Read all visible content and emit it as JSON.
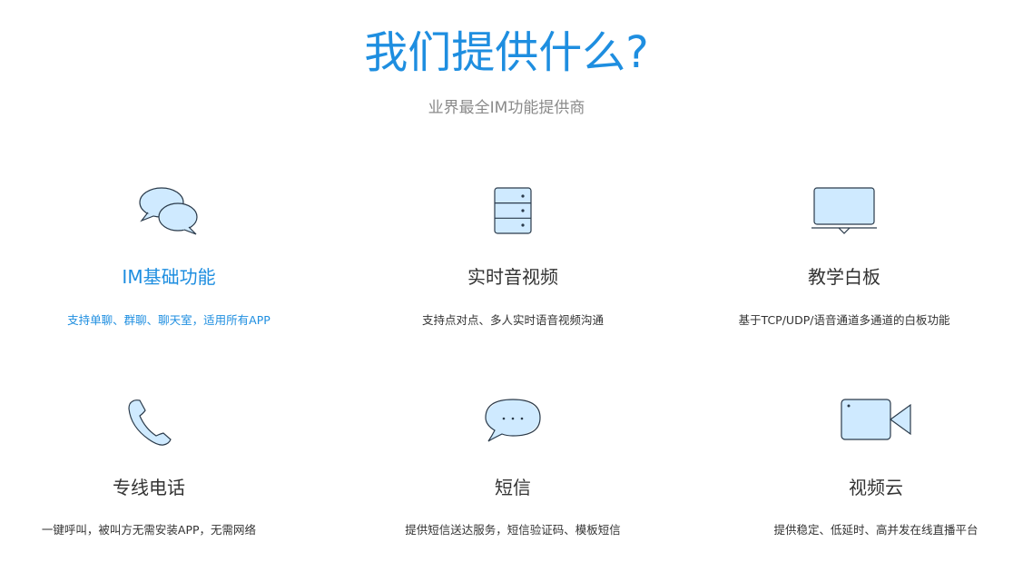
{
  "hero": {
    "title": "我们提供什么?",
    "subtitle": "业界最全IM功能提供商"
  },
  "colors": {
    "accent": "#1e8ee0",
    "text": "#333333",
    "subtle": "#8a8a8a",
    "icon_fill": "#cfeaff"
  },
  "features": [
    {
      "name": "IM基础功能",
      "desc": "支持单聊、群聊、聊天室，适用所有APP",
      "icon": "chat-bubbles-icon",
      "active": true
    },
    {
      "name": "实时音视频",
      "desc": "支持点对点、多人实时语音视频沟通",
      "icon": "server-icon",
      "active": false
    },
    {
      "name": "教学白板",
      "desc": "基于TCP/UDP/语音通道多通道的白板功能",
      "icon": "whiteboard-icon",
      "active": false
    },
    {
      "name": "专线电话",
      "desc": "一键呼叫，被叫方无需安装APP，无需网络",
      "icon": "phone-icon",
      "active": false
    },
    {
      "name": "短信",
      "desc": "提供短信送达服务，短信验证码、模板短信",
      "icon": "message-bubble-icon",
      "active": false
    },
    {
      "name": "视频云",
      "desc": "提供稳定、低延时、高并发在线直播平台",
      "icon": "video-camera-icon",
      "active": false
    }
  ]
}
